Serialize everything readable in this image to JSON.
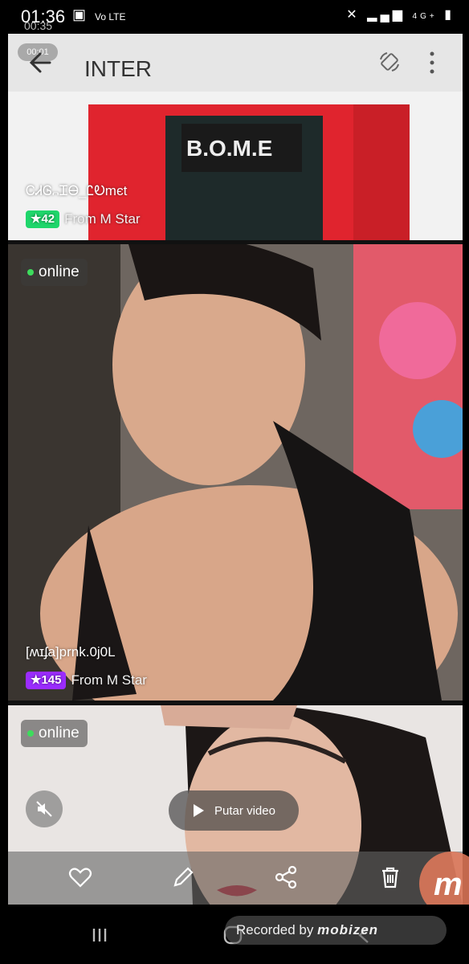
{
  "status_bar": {
    "time": "01:36",
    "recording_timer": "00:35",
    "indicators": "Vo LTE",
    "network": "4G+"
  },
  "app_bar": {
    "title": "INTER",
    "recording_pill": "00:01",
    "icons": [
      "back-arrow-icon",
      "rotate-icon",
      "more-vert-icon"
    ]
  },
  "feed": [
    {
      "username": "ᏟᏗᎶ᎔ᏆᎾ_ᏝᎧmєt",
      "level": "42",
      "level_color": "#1fd66b",
      "from": "From M Star"
    },
    {
      "status": "online",
      "username": "[ʍɪʄa]prnk.0j0L",
      "level": "145",
      "level_color": "#9b2cff",
      "from": "From M Star"
    },
    {
      "status": "online"
    }
  ],
  "video_controls": {
    "play_label": "Putar video"
  },
  "bottom_actions": [
    "heart-icon",
    "edit-icon",
    "share-icon",
    "delete-icon"
  ],
  "watermark": {
    "text": "Recorded by",
    "brand": "mobizen"
  },
  "colors": {
    "online_dot": "#3ddc5c",
    "app_bar_bg": "#e6e6e6"
  }
}
